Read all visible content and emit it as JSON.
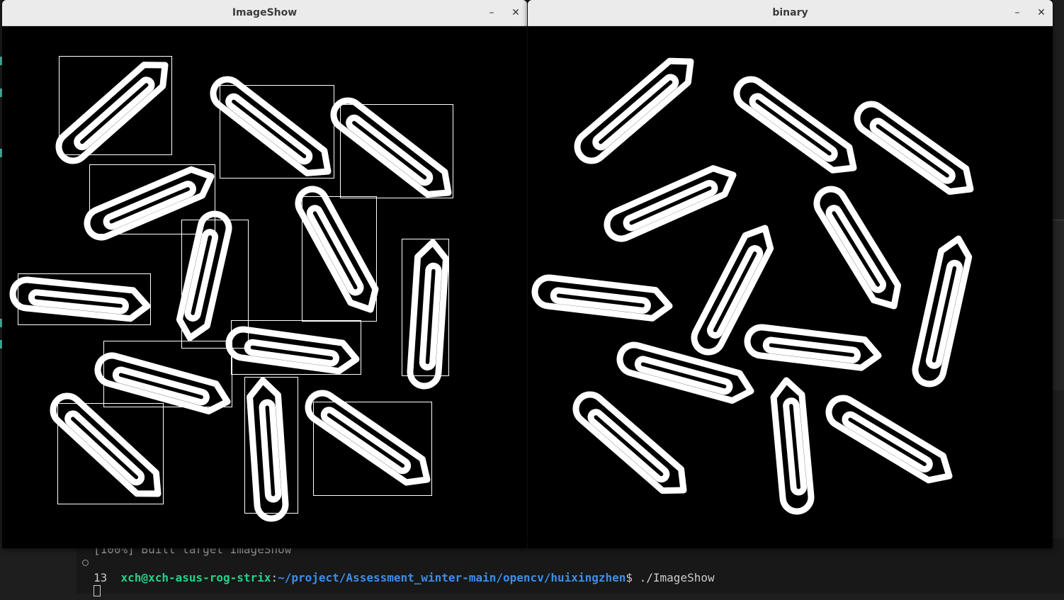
{
  "windows": {
    "imageshow": {
      "title": "ImageShow",
      "minimize": "–",
      "close": "✕"
    },
    "binary": {
      "title": "binary",
      "minimize": "–",
      "close": "✕"
    }
  },
  "terminal": {
    "build_line": "[100%] Built target ImageShow",
    "prompt_user": "xch@xch-asus-rog-strix",
    "prompt_sep": ":",
    "prompt_path": "~/project/Assessment_winter-main/opencv/huixingzhen",
    "prompt_cmd": "$ ./ImageShow",
    "output": "13"
  },
  "colors": {
    "terminal_bg": "#181818",
    "user": "#23d18b",
    "path": "#3b8eea",
    "shape": "#ffffff"
  }
}
